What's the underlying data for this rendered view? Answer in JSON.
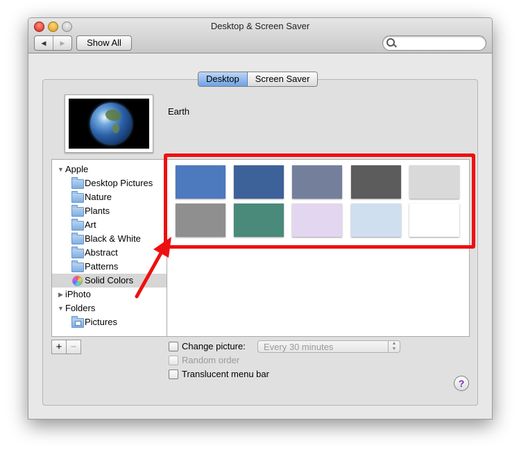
{
  "window": {
    "title": "Desktop & Screen Saver",
    "nav_back": "◀",
    "nav_forward": "▶",
    "show_all": "Show All",
    "search_placeholder": ""
  },
  "tabs": [
    {
      "label": "Desktop",
      "active": true
    },
    {
      "label": "Screen Saver",
      "active": false
    }
  ],
  "preview": {
    "name": "Earth"
  },
  "sidebar": {
    "items": [
      {
        "label": "Apple",
        "kind": "group",
        "expanded": true
      },
      {
        "label": "Desktop Pictures",
        "kind": "folder"
      },
      {
        "label": "Nature",
        "kind": "folder"
      },
      {
        "label": "Plants",
        "kind": "folder"
      },
      {
        "label": "Art",
        "kind": "folder"
      },
      {
        "label": "Black & White",
        "kind": "folder"
      },
      {
        "label": "Abstract",
        "kind": "folder"
      },
      {
        "label": "Patterns",
        "kind": "folder"
      },
      {
        "label": "Solid Colors",
        "kind": "colorwheel",
        "selected": true
      },
      {
        "label": "iPhoto",
        "kind": "group",
        "expanded": false
      },
      {
        "label": "Folders",
        "kind": "group",
        "expanded": true
      },
      {
        "label": "Pictures",
        "kind": "picfolder"
      }
    ],
    "add_label": "+",
    "remove_label": "−"
  },
  "swatches": [
    "#4d79bf",
    "#3d6199",
    "#747f9c",
    "#5c5c5c",
    "#d9d9d9",
    "#8f8f8f",
    "#4a8a7a",
    "#e3d6f0",
    "#cfdff0",
    "#ffffff"
  ],
  "options": {
    "change_picture": "Change picture:",
    "interval": "Every 30 minutes",
    "random_order": "Random order",
    "translucent_menu_bar": "Translucent menu bar"
  },
  "help": "?",
  "annotation_color": "#ee1010"
}
